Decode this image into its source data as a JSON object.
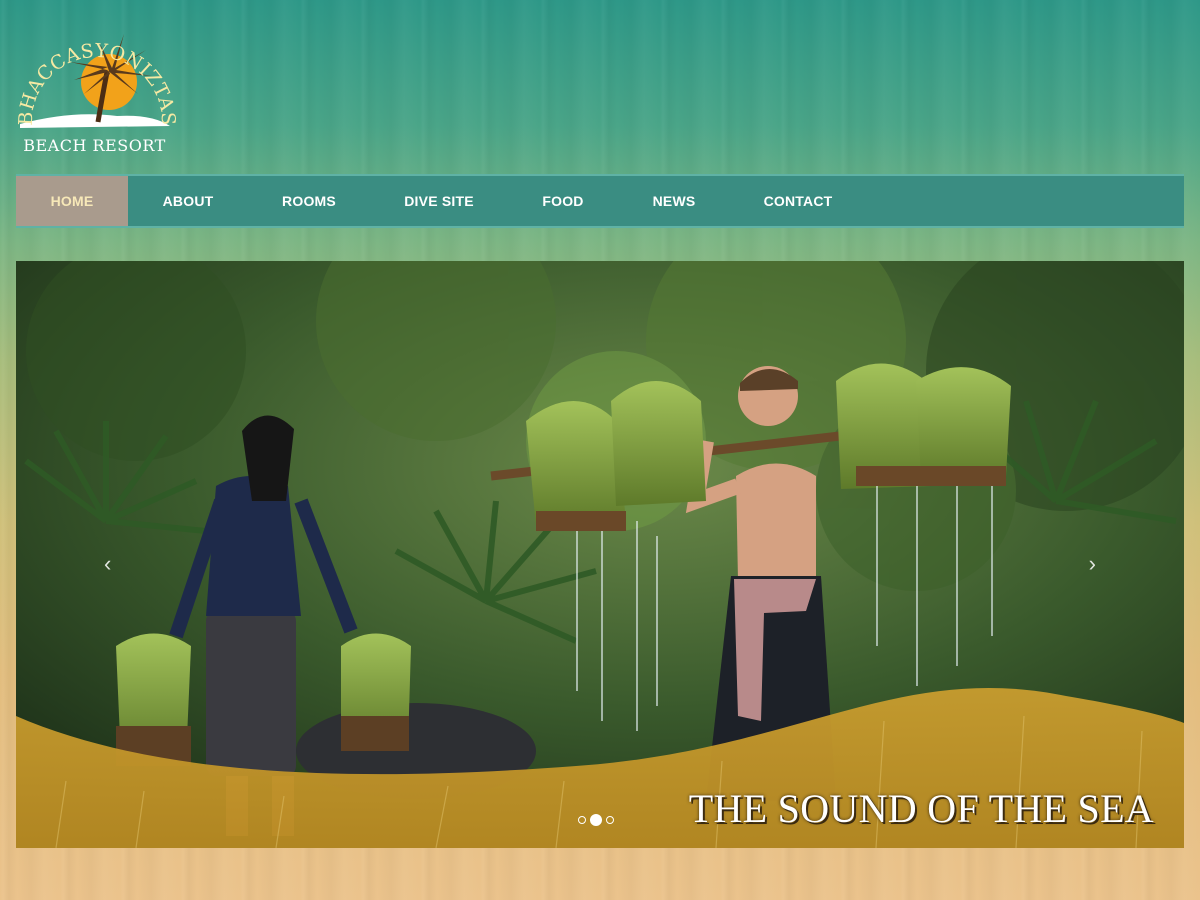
{
  "brand": {
    "name_arc": "BHACCASYONIZTAS",
    "tagline": "BEACH RESORT"
  },
  "nav": {
    "items": [
      {
        "label": "HOME",
        "active": true
      },
      {
        "label": "ABOUT",
        "active": false
      },
      {
        "label": "ROOMS",
        "active": false
      },
      {
        "label": "DIVE SITE",
        "active": false
      },
      {
        "label": "FOOD",
        "active": false
      },
      {
        "label": "NEWS",
        "active": false
      },
      {
        "label": "CONTACT",
        "active": false
      }
    ]
  },
  "slider": {
    "caption": "THE SOUND OF THE SEA",
    "prev_icon": "‹",
    "next_icon": "›",
    "slide_count": 3,
    "active_slide": 2
  },
  "colors": {
    "nav_bg": "#3a8d82",
    "nav_active_bg": "#a99b8d",
    "wave_gold": "#c79a2c"
  },
  "icons": {
    "logo": "palm-tree-sun-icon",
    "prev": "chevron-left-icon",
    "next": "chevron-right-icon"
  }
}
